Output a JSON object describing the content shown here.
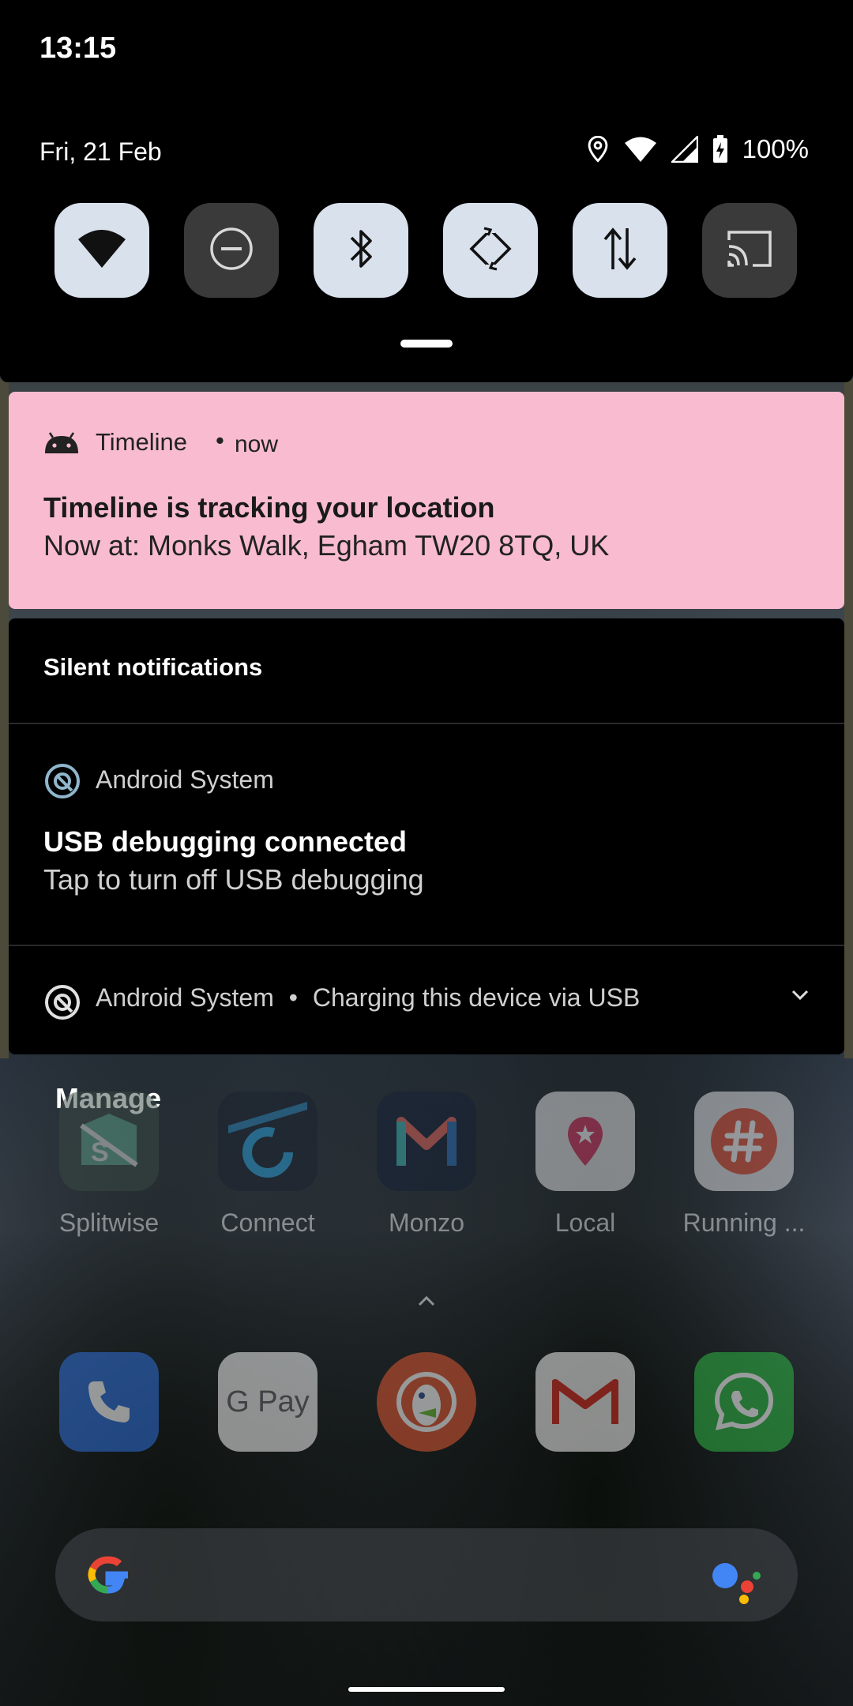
{
  "status_bar": {
    "time": "13:15",
    "date": "Fri, 21 Feb",
    "battery": "100%",
    "icons": [
      "location-icon",
      "wifi-icon",
      "cell-signal-icon",
      "battery-charging-icon"
    ]
  },
  "quick_settings": {
    "tiles": [
      {
        "name": "wifi",
        "icon": "wifi-icon",
        "state": "on"
      },
      {
        "name": "do-not-disturb",
        "icon": "dnd-icon",
        "state": "off"
      },
      {
        "name": "bluetooth",
        "icon": "bluetooth-icon",
        "state": "on"
      },
      {
        "name": "auto-rotate",
        "icon": "rotate-icon",
        "state": "on"
      },
      {
        "name": "mobile-data",
        "icon": "data-icon",
        "state": "on"
      },
      {
        "name": "cast",
        "icon": "cast-icon",
        "state": "off"
      }
    ]
  },
  "notifications": {
    "timeline": {
      "app": "Timeline",
      "separator": "•",
      "time": "now",
      "title": "Timeline is tracking your location",
      "text": "Now at: Monks Walk, Egham TW20 8TQ, UK",
      "color": "#f8bbd0"
    },
    "silent_header": "Silent notifications",
    "usb": {
      "app": "Android System",
      "title": "USB debugging connected",
      "text": "Tap to turn off USB debugging"
    },
    "charging": {
      "app": "Android System",
      "separator": "•",
      "text": "Charging this device via USB"
    }
  },
  "home": {
    "manage_label": "Manage",
    "apps_row1": [
      {
        "label": "Splitwise",
        "icon": "splitwise-icon"
      },
      {
        "label": "Connect",
        "icon": "garmin-connect-icon"
      },
      {
        "label": "Monzo",
        "icon": "monzo-icon"
      },
      {
        "label": "Local",
        "icon": "local-icon"
      },
      {
        "label": "Running ...",
        "icon": "running-icon"
      }
    ],
    "dock": [
      {
        "label": "Phone",
        "icon": "phone-icon"
      },
      {
        "label": "G Pay",
        "icon": "gpay-icon"
      },
      {
        "label": "DuckDuckGo",
        "icon": "duckduckgo-icon"
      },
      {
        "label": "Gmail",
        "icon": "gmail-icon"
      },
      {
        "label": "WhatsApp",
        "icon": "whatsapp-icon"
      }
    ],
    "gpay_text": "G Pay"
  }
}
